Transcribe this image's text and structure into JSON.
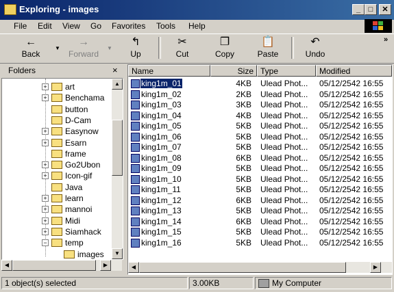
{
  "window": {
    "title": "Exploring - images",
    "minimize": "_",
    "maximize": "□",
    "close": "✕"
  },
  "menu": [
    "File",
    "Edit",
    "View",
    "Go",
    "Favorites",
    "Tools",
    "Help"
  ],
  "toolbar": {
    "back": {
      "label": "Back",
      "icon": "←"
    },
    "forward": {
      "label": "Forward",
      "icon": "→"
    },
    "up": {
      "label": "Up",
      "icon": "↰"
    },
    "cut": {
      "label": "Cut",
      "icon": "✂"
    },
    "copy": {
      "label": "Copy",
      "icon": "❐"
    },
    "paste": {
      "label": "Paste",
      "icon": "📋"
    },
    "undo": {
      "label": "Undo",
      "icon": "↶"
    },
    "more": "»"
  },
  "folders": {
    "title": "Folders",
    "close": "×",
    "items": [
      {
        "label": "art",
        "expand": "+"
      },
      {
        "label": "Benchama",
        "expand": "+"
      },
      {
        "label": "button",
        "expand": ""
      },
      {
        "label": "D-Cam",
        "expand": ""
      },
      {
        "label": "Easynow",
        "expand": "+"
      },
      {
        "label": "Esarn",
        "expand": "+"
      },
      {
        "label": "frame",
        "expand": ""
      },
      {
        "label": "Go2Ubon",
        "expand": "+"
      },
      {
        "label": "Icon-gif",
        "expand": "+"
      },
      {
        "label": "Java",
        "expand": ""
      },
      {
        "label": "learn",
        "expand": "+"
      },
      {
        "label": "mannoi",
        "expand": "+"
      },
      {
        "label": "Midi",
        "expand": "+"
      },
      {
        "label": "Siamhack",
        "expand": "+"
      },
      {
        "label": "temp",
        "expand": "−"
      },
      {
        "label": "images",
        "expand": ""
      }
    ]
  },
  "columns": {
    "name": "Name",
    "size": "Size",
    "type": "Type",
    "modified": "Modified"
  },
  "files": [
    {
      "name": "king1m_01",
      "size": "4KB",
      "type": "Ulead Phot...",
      "modified": "05/12/2542 16:55"
    },
    {
      "name": "king1m_02",
      "size": "2KB",
      "type": "Ulead Phot...",
      "modified": "05/12/2542 16:55"
    },
    {
      "name": "king1m_03",
      "size": "3KB",
      "type": "Ulead Phot...",
      "modified": "05/12/2542 16:55"
    },
    {
      "name": "king1m_04",
      "size": "4KB",
      "type": "Ulead Phot...",
      "modified": "05/12/2542 16:55"
    },
    {
      "name": "king1m_05",
      "size": "5KB",
      "type": "Ulead Phot...",
      "modified": "05/12/2542 16:55"
    },
    {
      "name": "king1m_06",
      "size": "5KB",
      "type": "Ulead Phot...",
      "modified": "05/12/2542 16:55"
    },
    {
      "name": "king1m_07",
      "size": "5KB",
      "type": "Ulead Phot...",
      "modified": "05/12/2542 16:55"
    },
    {
      "name": "king1m_08",
      "size": "6KB",
      "type": "Ulead Phot...",
      "modified": "05/12/2542 16:55"
    },
    {
      "name": "king1m_09",
      "size": "5KB",
      "type": "Ulead Phot...",
      "modified": "05/12/2542 16:55"
    },
    {
      "name": "king1m_10",
      "size": "5KB",
      "type": "Ulead Phot...",
      "modified": "05/12/2542 16:55"
    },
    {
      "name": "king1m_11",
      "size": "5KB",
      "type": "Ulead Phot...",
      "modified": "05/12/2542 16:55"
    },
    {
      "name": "king1m_12",
      "size": "6KB",
      "type": "Ulead Phot...",
      "modified": "05/12/2542 16:55"
    },
    {
      "name": "king1m_13",
      "size": "5KB",
      "type": "Ulead Phot...",
      "modified": "05/12/2542 16:55"
    },
    {
      "name": "king1m_14",
      "size": "6KB",
      "type": "Ulead Phot...",
      "modified": "05/12/2542 16:55"
    },
    {
      "name": "king1m_15",
      "size": "5KB",
      "type": "Ulead Phot...",
      "modified": "05/12/2542 16:55"
    },
    {
      "name": "king1m_16",
      "size": "5KB",
      "type": "Ulead Phot...",
      "modified": "05/12/2542 16:55"
    }
  ],
  "status": {
    "selected": "1 object(s) selected",
    "size": "3.00KB",
    "location": "My Computer"
  },
  "colors": {
    "titlebar_start": "#0a246a",
    "titlebar_end": "#3a6ea5",
    "selection": "#0a246a",
    "face": "#d4d0c8"
  }
}
